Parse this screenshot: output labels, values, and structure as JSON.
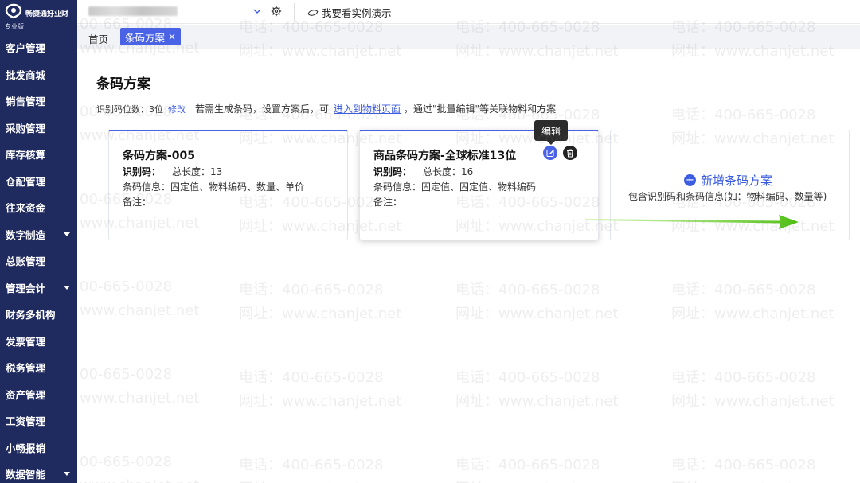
{
  "app": {
    "brand_name": "畅捷通好业财",
    "edition": "专业版"
  },
  "sidebar": {
    "items": [
      {
        "label": "客户管理",
        "has_caret": false
      },
      {
        "label": "批发商城",
        "has_caret": false
      },
      {
        "label": "销售管理",
        "has_caret": false
      },
      {
        "label": "采购管理",
        "has_caret": false
      },
      {
        "label": "库存核算",
        "has_caret": false
      },
      {
        "label": "仓配管理",
        "has_caret": false
      },
      {
        "label": "往来资金",
        "has_caret": false
      },
      {
        "label": "数字制造",
        "has_caret": true
      },
      {
        "label": "总账管理",
        "has_caret": false
      },
      {
        "label": "管理会计",
        "has_caret": true
      },
      {
        "label": "财务多机构",
        "has_caret": false
      },
      {
        "label": "发票管理",
        "has_caret": false
      },
      {
        "label": "税务管理",
        "has_caret": false
      },
      {
        "label": "资产管理",
        "has_caret": false
      },
      {
        "label": "工资管理",
        "has_caret": false
      },
      {
        "label": "小畅报销",
        "has_caret": false
      },
      {
        "label": "数据智能",
        "has_caret": true
      }
    ]
  },
  "topbar": {
    "demo_label": "我要看实例演示"
  },
  "tabs": {
    "home_label": "首页",
    "active_label": "条码方案",
    "close_glyph": "×"
  },
  "page": {
    "title": "条码方案",
    "id_digits_label": "识别码位数：3位",
    "edit_link": "修改",
    "hint_before": "若需生成条码，设置方案后，可",
    "material_link": "进入到物料页面",
    "hint_after": "，通过\"批量编辑\"等关联物料和方案"
  },
  "cards": [
    {
      "title": "条码方案-005",
      "id_label": "识别码：",
      "length_text": "总长度：13",
      "info_text": "条码信息：固定值、物料编码、数量、单价",
      "note_text": "备注："
    },
    {
      "title": "商品条码方案-全球标准13位",
      "id_label": "识别码：",
      "length_text": "总长度：16",
      "info_text": "条码信息：固定值、固定值、物料编码",
      "note_text": "备注："
    }
  ],
  "tooltip": {
    "text": "编辑"
  },
  "add_card": {
    "title": "新增条码方案",
    "plus_glyph": "+",
    "description": "包含识别码和条码信息(如：物料编码、数量等)"
  },
  "watermark": {
    "phone": "电话：400-665-0028",
    "site": "网址：www.chanjet.net",
    "phone_partial": "00-665-0028",
    "site_partial": "www.chanjet.net"
  },
  "colors": {
    "sidebar_bg": "#1f2a5e",
    "accent": "#4a63e6",
    "link": "#3b5ce0",
    "arrow": "#6ccb1a"
  }
}
